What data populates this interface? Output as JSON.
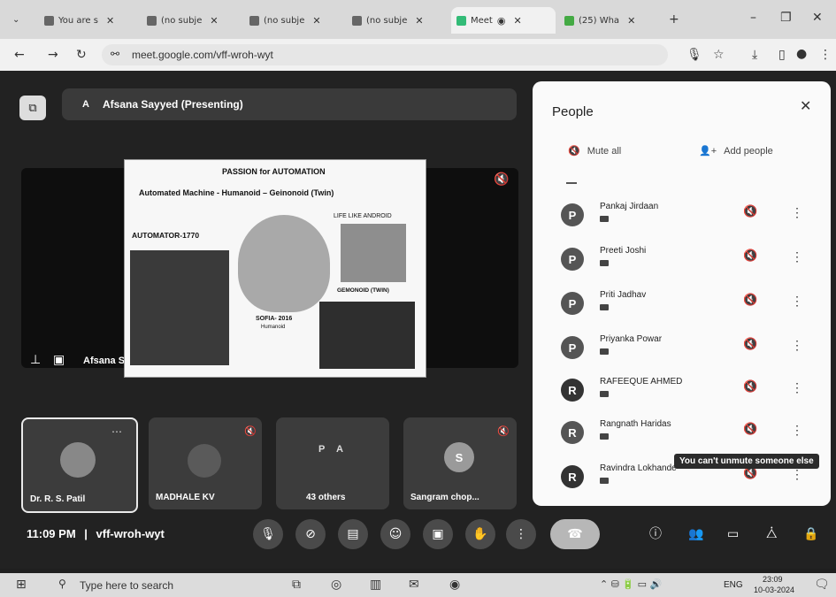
{
  "browser": {
    "tabs": [
      {
        "label": "You are s",
        "active": false
      },
      {
        "label": "(no subje",
        "active": false
      },
      {
        "label": "(no subje",
        "active": false
      },
      {
        "label": "(no subje",
        "active": false
      },
      {
        "label": "Meet",
        "active": true
      },
      {
        "label": "(25) Wha",
        "active": false
      }
    ],
    "url": "meet.google.com/vff-wroh-wyt"
  },
  "meet": {
    "presenter_chip": "Afsana Sayyed (Presenting)",
    "presenter_initial": "A",
    "main_tile_name": "Afsana Sayyed",
    "slide": {
      "title": "PASSION for AUTOMATION",
      "subtitle": "Automated Machine - Humanoid – Geinonoid (Twin)",
      "label_left": "AUTOMATOR-1770",
      "label_right_top": "LIFE LIKE ANDROID",
      "label_center_1": "SOFIA- 2016",
      "label_center_2": "Humanoid",
      "label_right_mid": "GEMONOID (TWIN)"
    },
    "tiles": [
      {
        "name": "Dr. R. S. Patil"
      },
      {
        "name": "MADHALE KV"
      },
      {
        "name": "43 others",
        "initials": [
          "P",
          "A"
        ]
      },
      {
        "name": "Sangram chop...",
        "initial": "S"
      }
    ],
    "time": "11:09 PM",
    "meeting_code": "vff-wroh-wyt"
  },
  "people": {
    "title": "People",
    "mute_all": "Mute all",
    "add_people": "Add people",
    "list": [
      {
        "initial": "P",
        "name": "Pankaj Jirdaan"
      },
      {
        "initial": "P",
        "name": "Preeti Joshi"
      },
      {
        "initial": "P",
        "name": "Priti Jadhav"
      },
      {
        "initial": "P",
        "name": "Priyanka Powar"
      },
      {
        "initial": "R",
        "name": "RAFEEQUE AHMED"
      },
      {
        "initial": "R",
        "name": "Rangnath Haridas"
      },
      {
        "initial": "R",
        "name": "Ravindra Lokhande"
      }
    ],
    "tooltip": "You can't unmute someone else"
  },
  "taskbar": {
    "search_placeholder": "Type here to search",
    "lang": "ENG",
    "time": "23:09",
    "date": "10-03-2024"
  },
  "colors": {
    "panel_bg": "#fafafa",
    "meet_bg": "#222222",
    "end_call": "#b7b7b7"
  }
}
